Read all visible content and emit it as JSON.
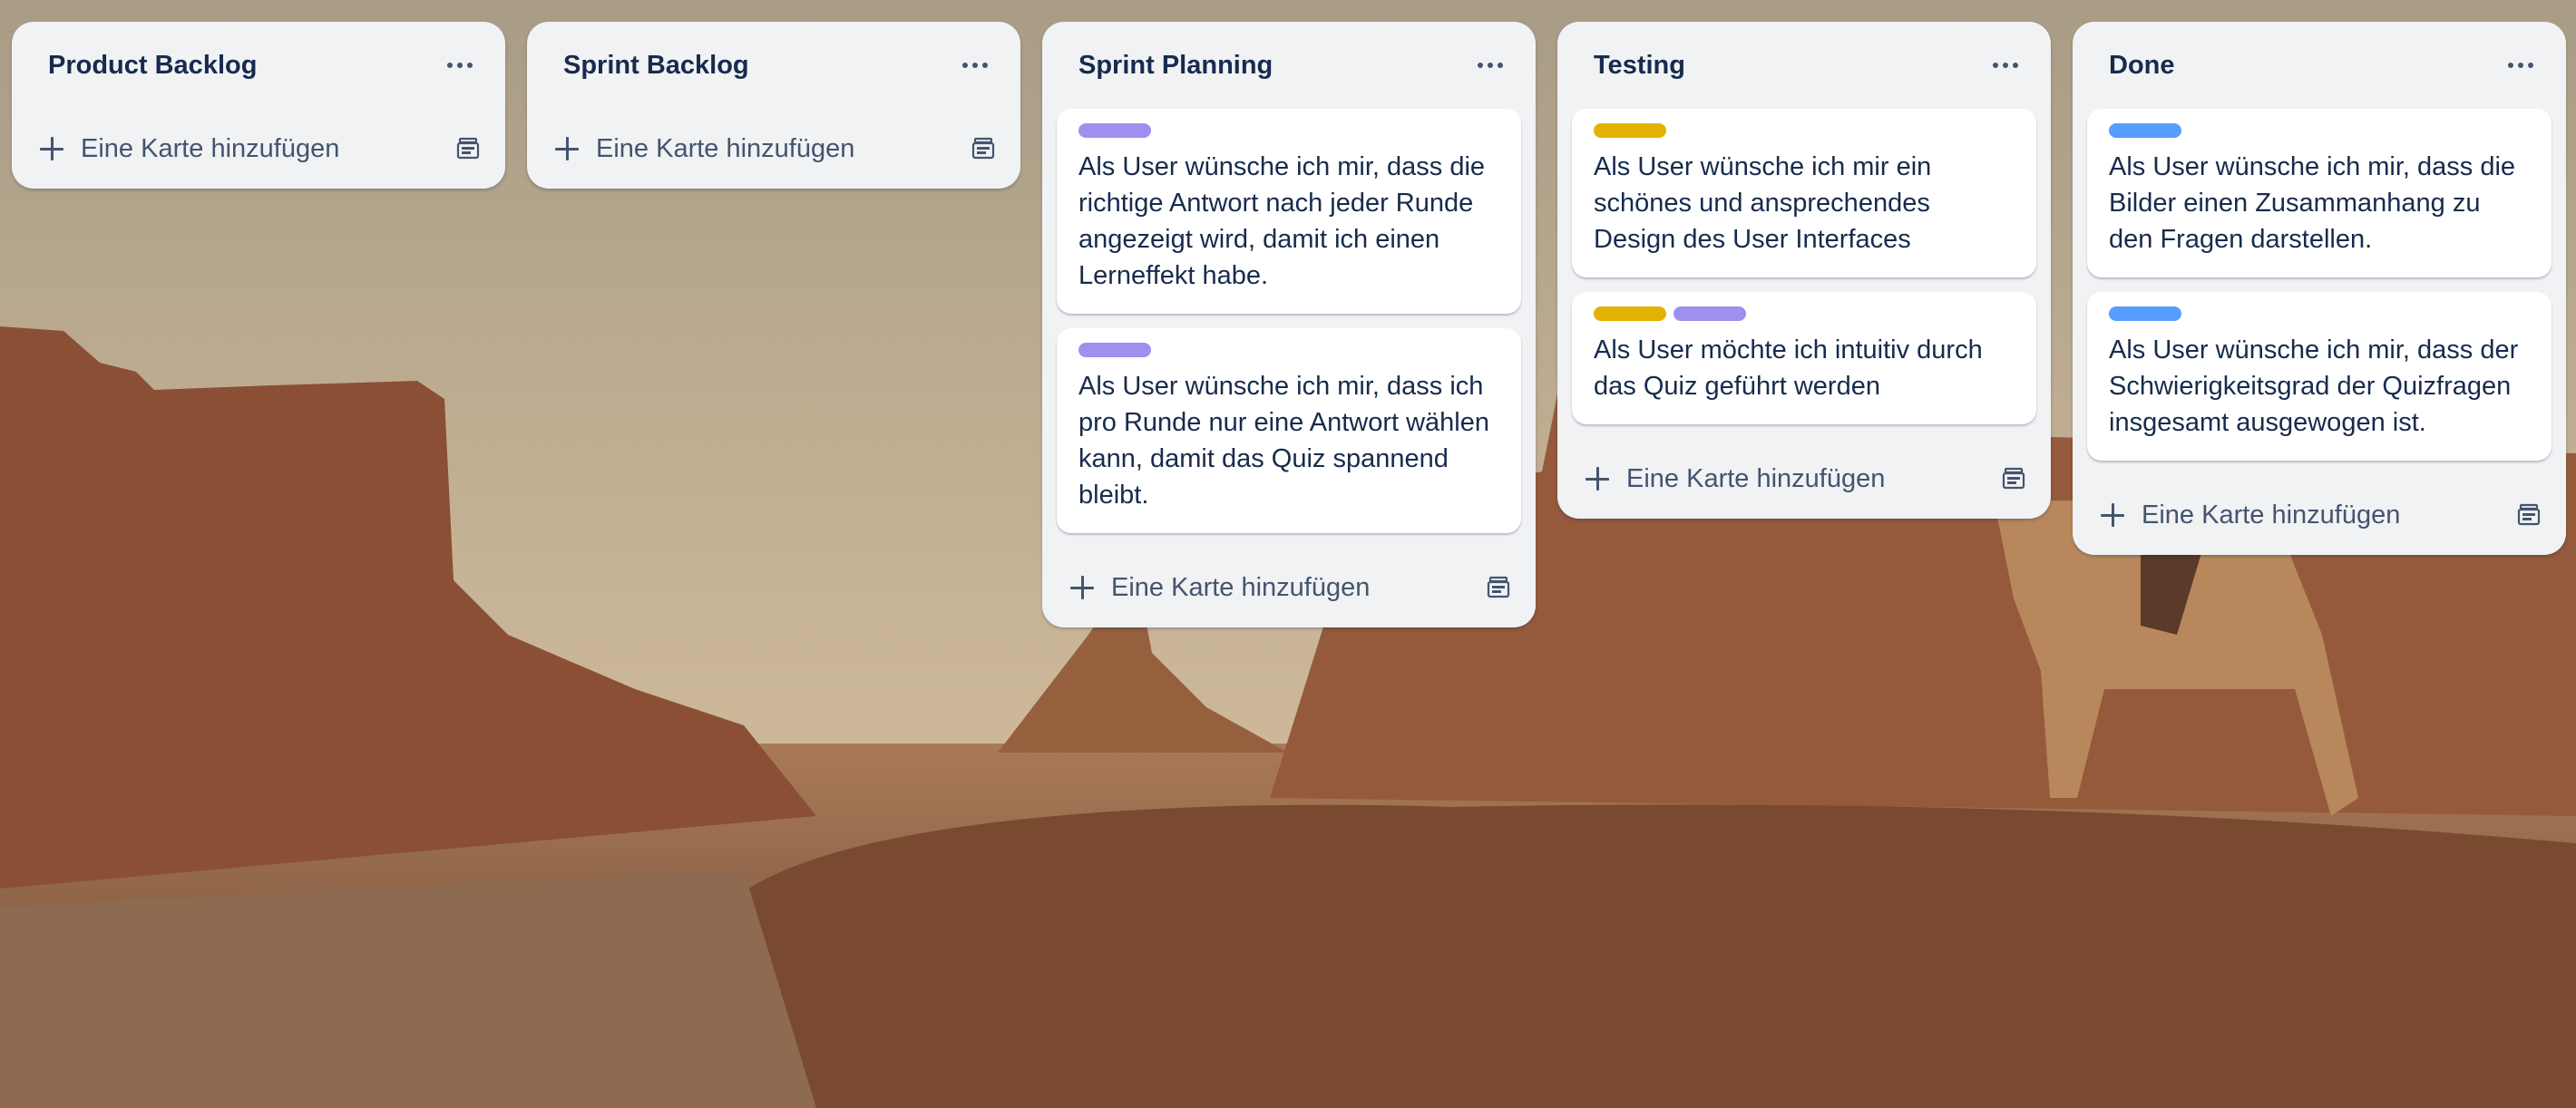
{
  "colors": {
    "label_purple": "#9f8fef",
    "label_yellow": "#e2b203",
    "label_blue": "#579dff",
    "list_background": "#f1f2f4",
    "text": "#172b4d"
  },
  "icons": {
    "menu": "ellipsis-icon",
    "add": "plus-icon",
    "template": "card-template-icon"
  },
  "lists": [
    {
      "title": "Product Backlog",
      "add_label": "Eine Karte hinzufügen",
      "cards": []
    },
    {
      "title": "Sprint Backlog",
      "add_label": "Eine Karte hinzufügen",
      "cards": []
    },
    {
      "title": "Sprint Planning",
      "add_label": "Eine Karte hinzufügen",
      "cards": [
        {
          "labels": [
            "purple"
          ],
          "text": "Als User wünsche ich mir, dass die richtige Antwort nach jeder Runde angezeigt wird, damit ich einen Lerneffekt habe."
        },
        {
          "labels": [
            "purple"
          ],
          "text": "Als User wünsche ich mir, dass ich pro Runde nur eine Antwort wählen kann, damit das Quiz spannend bleibt."
        }
      ]
    },
    {
      "title": "Testing",
      "add_label": "Eine Karte hinzufügen",
      "cards": [
        {
          "labels": [
            "yellow"
          ],
          "text": "Als User wünsche ich mir ein schönes und ansprechendes Design des User Interfaces"
        },
        {
          "labels": [
            "yellow",
            "purple"
          ],
          "text": "Als User möchte ich intuitiv durch das Quiz geführt werden"
        }
      ]
    },
    {
      "title": "Done",
      "add_label": "Eine Karte hinzufügen",
      "cards": [
        {
          "labels": [
            "blue"
          ],
          "text": "Als User wünsche ich mir, dass die Bilder einen Zusammanhang zu den Fragen darstellen."
        },
        {
          "labels": [
            "blue"
          ],
          "text": "Als User wünsche ich mir, dass der Schwierigkeitsgrad der Quizfragen insgesamt ausgewogen ist."
        }
      ]
    }
  ]
}
